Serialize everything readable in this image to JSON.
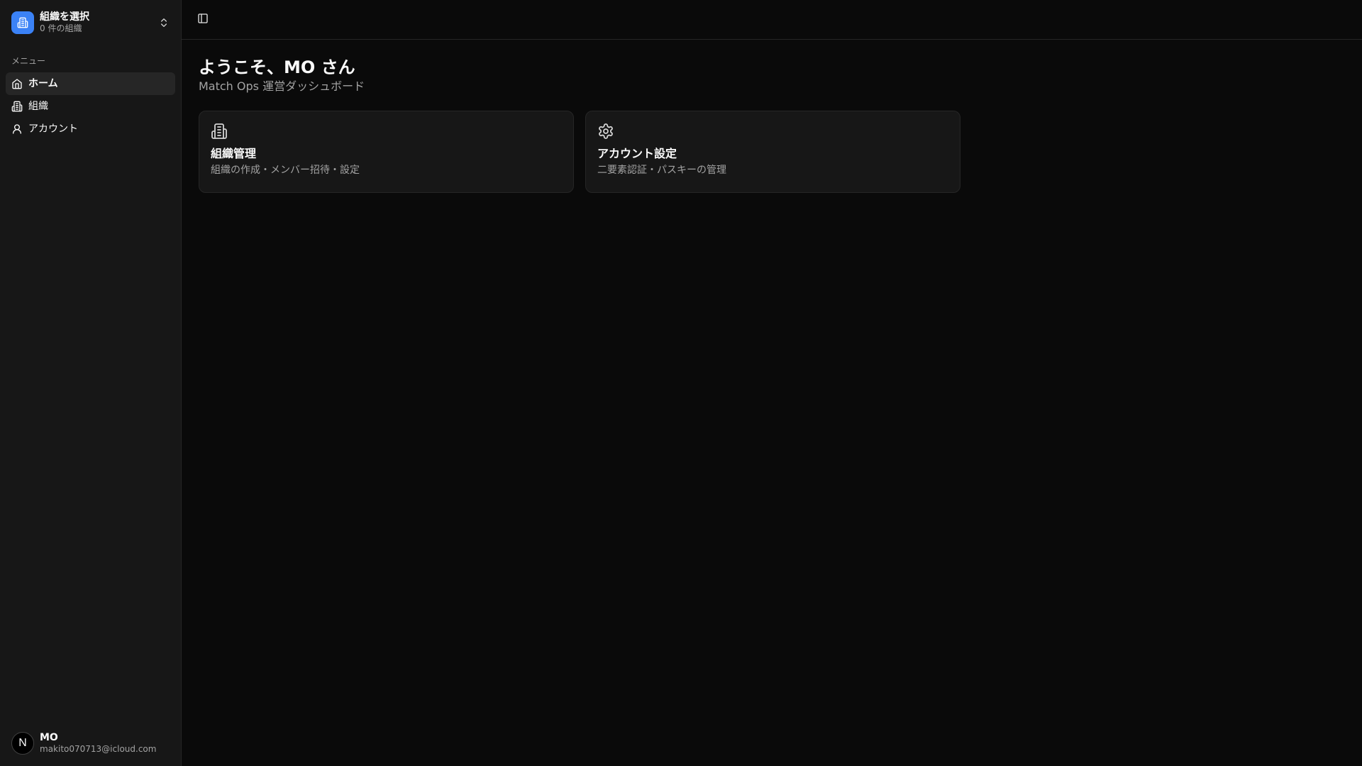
{
  "org_switcher": {
    "title": "組織を選択",
    "subtitle": "0 件の組織",
    "icon": "building-icon",
    "chevron_icon": "chevrons-up-down-icon"
  },
  "sidebar": {
    "menu_label": "メニュー",
    "items": [
      {
        "label": "ホーム",
        "icon": "home-icon",
        "active": true
      },
      {
        "label": "組織",
        "icon": "building-icon",
        "active": false
      },
      {
        "label": "アカウント",
        "icon": "user-icon",
        "active": false
      }
    ]
  },
  "user": {
    "avatar_letter": "N",
    "name": "MO",
    "email": "makito070713@icloud.com"
  },
  "main": {
    "title": "ようこそ、MO さん",
    "subtitle": "Match Ops 運営ダッシュボード",
    "cards": [
      {
        "title": "組織管理",
        "description": "組織の作成・メンバー招待・設定",
        "icon": "building-icon"
      },
      {
        "title": "アカウント設定",
        "description": "二要素認証・パスキーの管理",
        "icon": "gear-icon"
      }
    ]
  },
  "colors": {
    "background": "#0a0a0a",
    "sidebar": "#171717",
    "accent": "#3b82f6",
    "muted_text": "#a3a3a3"
  }
}
